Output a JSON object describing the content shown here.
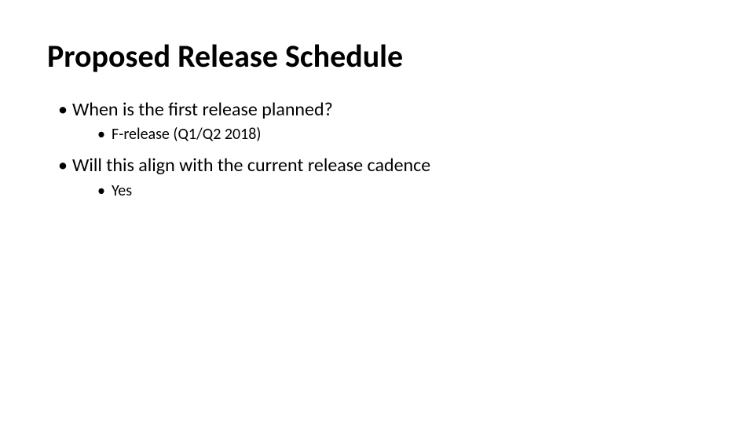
{
  "slide": {
    "title": "Proposed Release Schedule",
    "bullets": [
      {
        "text": "When is the first release planned?",
        "sub": [
          "F-release (Q1/Q2 2018)"
        ]
      },
      {
        "text": "Will this align with the current release cadence",
        "sub": [
          "Yes"
        ]
      }
    ]
  }
}
